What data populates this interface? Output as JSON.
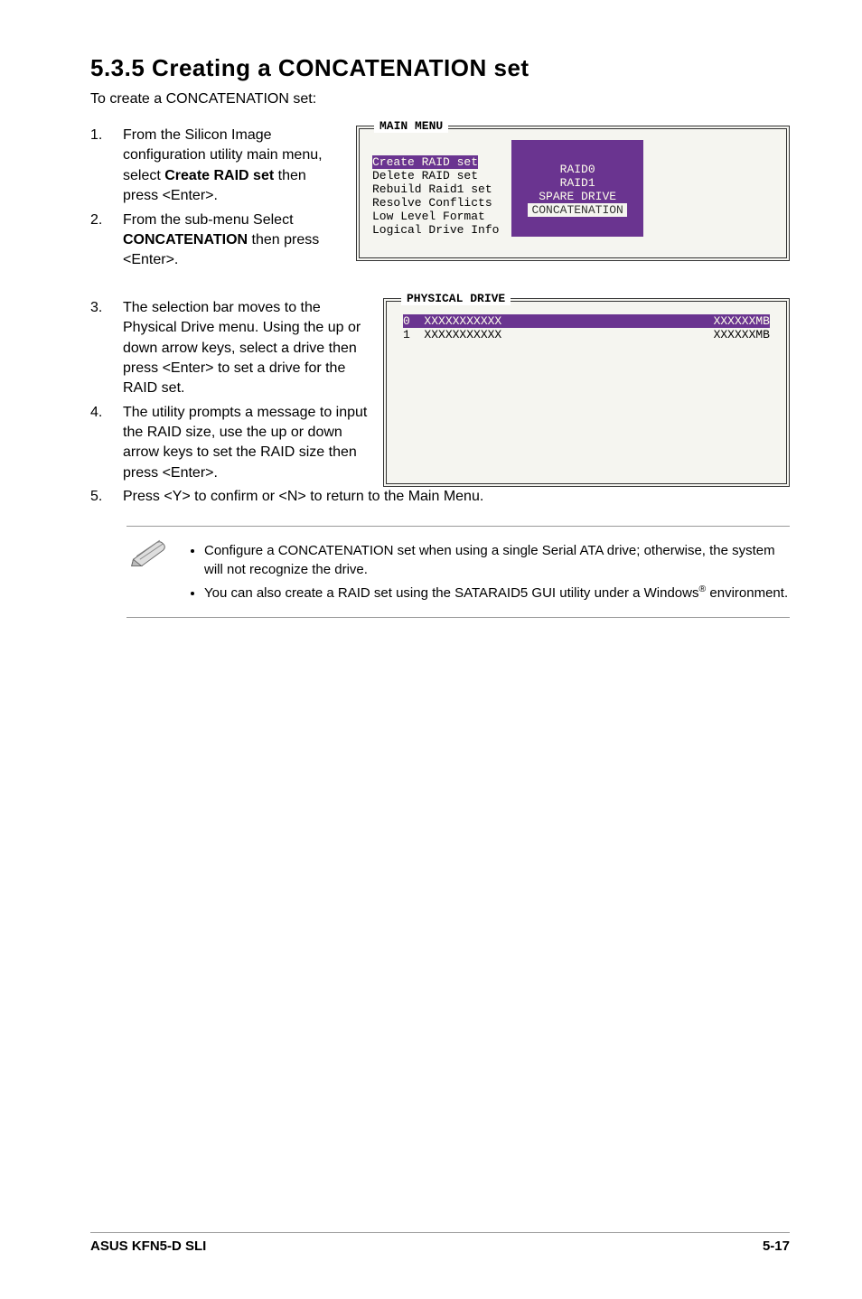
{
  "heading": "5.3.5   Creating a CONCATENATION set",
  "intro": "To create a CONCATENATION set:",
  "step1": {
    "num": "1.",
    "text_before": "From the Silicon Image configuration utility main menu, select ",
    "bold": "Create RAID set",
    "text_after": " then press <Enter>."
  },
  "step2": {
    "num": "2.",
    "text_before": "From the sub-menu Select ",
    "bold": "CONCATENATION",
    "text_after": " then press <Enter>."
  },
  "main_menu": {
    "legend": "MAIN MENU",
    "items": [
      "Create RAID set",
      "Delete RAID set",
      "Rebuild Raid1 set",
      "Resolve Conflicts",
      "Low Level Format",
      "Logical Drive Info"
    ],
    "selected": "Create RAID set",
    "sub_items": [
      "RAID0",
      "RAID1",
      "SPARE DRIVE",
      "CONCATENATION"
    ],
    "sub_selected": "CONCATENATION"
  },
  "step3": {
    "num": "3.",
    "text": "The selection bar moves to the Physical Drive menu. Using the up or down arrow keys, select a drive then press <Enter> to set a drive for the RAID set."
  },
  "step4": {
    "num": "4.",
    "text": "The utility prompts a message to input the RAID size, use the up or down arrow keys to set the RAID size then press <Enter>."
  },
  "step5": {
    "num": "5.",
    "text": "Press <Y> to confirm or <N> to return to the Main Menu."
  },
  "phys": {
    "legend": "PHYSICAL DRIVE",
    "rows": [
      {
        "idx": "0",
        "name": "XXXXXXXXXXX",
        "size": "XXXXXXMB",
        "sel": true
      },
      {
        "idx": "1",
        "name": "XXXXXXXXXXX",
        "size": "XXXXXXMB",
        "sel": false
      }
    ]
  },
  "notes": [
    "Configure a CONCATENATION set when using a single Serial ATA drive; otherwise, the system will not recognize the drive.",
    "You can also create a RAID set using the SATARAID5 GUI utility under a Windows® environment."
  ],
  "footer_left": "ASUS KFN5-D SLI",
  "footer_right": "5-17"
}
